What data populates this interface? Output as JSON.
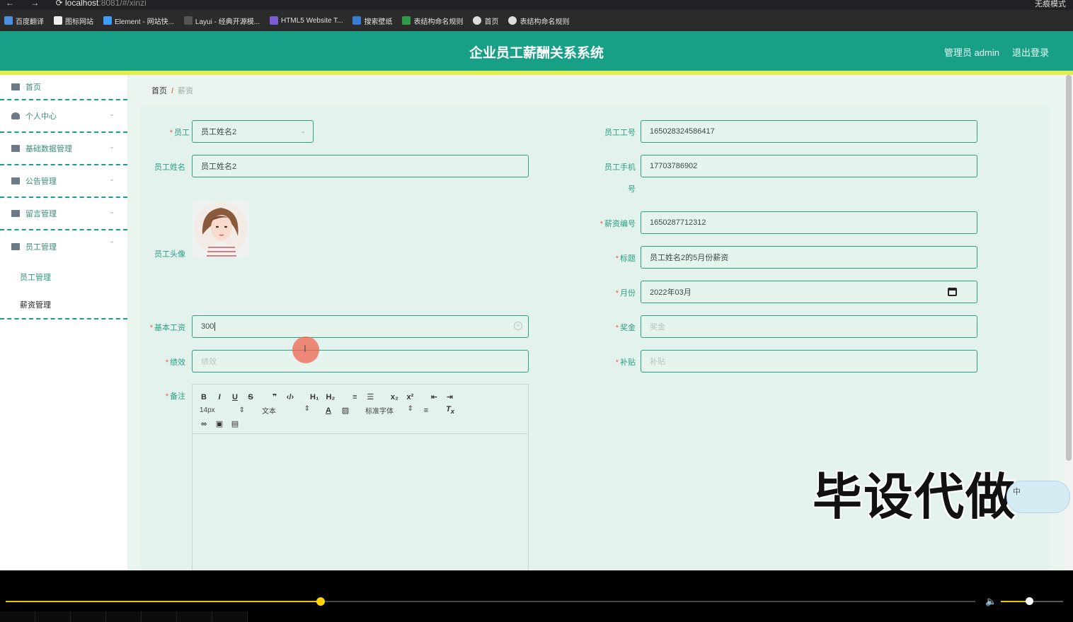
{
  "browser": {
    "nav_icons": "← → ⟳",
    "url_host": "localhost",
    "url_rest": ":8081/#/xinzi",
    "right_label": "无痕模式",
    "bookmarks": [
      "百度翻译",
      "图标网站",
      "Element - 网站快...",
      "Layui - 经典开源模...",
      "HTML5 Website T...",
      "搜索壁纸",
      "表结构命名规则",
      "首页",
      "表结构命名规则"
    ]
  },
  "header": {
    "title": "企业员工薪酬关系系统",
    "admin": "管理员 admin",
    "logout": "退出登录",
    "color": "#17a085"
  },
  "sidebar": {
    "home": "首页",
    "items": [
      {
        "label": "个人中心"
      },
      {
        "label": "基础数据管理"
      },
      {
        "label": "公告管理"
      },
      {
        "label": "留言管理"
      },
      {
        "label": "员工管理"
      }
    ],
    "subitems": [
      "员工管理",
      "薪资管理"
    ]
  },
  "breadcrumb": {
    "home": "首页",
    "sep": "/",
    "current": "薪资"
  },
  "form": {
    "employee_label": "员工",
    "employee_value": "员工姓名2",
    "name_label": "员工姓名",
    "name_value": "员工姓名2",
    "avatar_label": "员工头像",
    "base_salary_label": "基本工资",
    "base_salary_value": "300",
    "performance_label": "绩效",
    "performance_placeholder": "绩效",
    "remark_label": "备注",
    "emp_no_label": "员工工号",
    "emp_no_value": "165028324586417",
    "phone_label_1": "员工手机",
    "phone_label_2": "号",
    "phone_value": "17703786902",
    "salary_no_label": "薪资编号",
    "salary_no_value": "1650287712312",
    "title_label": "标题",
    "title_value": "员工姓名2的5月份薪资",
    "month_label": "月份",
    "month_value": "2022年03月",
    "bonus_label": "奖金",
    "bonus_placeholder": "奖金",
    "allowance_label": "补贴",
    "allowance_placeholder": "补贴"
  },
  "editor": {
    "row1": [
      "B",
      "I",
      "U",
      "S",
      "❞",
      "‹/›",
      "H₁",
      "H₂",
      "≡",
      "☰",
      "x₂",
      "x²",
      "⇤",
      "⇥"
    ],
    "font_size": "14px",
    "text_type": "文本",
    "font_family": "标准字体",
    "row3": [
      "🔗",
      "▣",
      "▤"
    ]
  },
  "overlay": {
    "watermark": "毕设代做",
    "badge_text": "中"
  },
  "player": {
    "progress": 0.325,
    "volume": 0.45
  }
}
